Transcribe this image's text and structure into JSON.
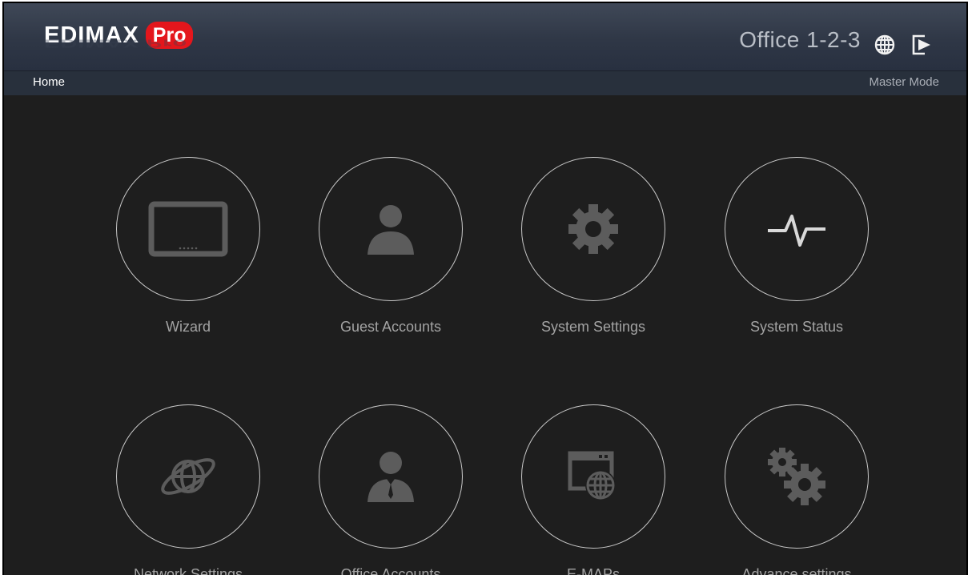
{
  "header": {
    "logo_main": "EDIMAX",
    "logo_pro": "Pro",
    "site_name": "Office 1-2-3",
    "language_icon": "globe-icon",
    "logout_icon": "logout-icon"
  },
  "navbar": {
    "breadcrumb": "Home",
    "mode": "Master Mode"
  },
  "tiles": [
    {
      "label": "Wizard",
      "icon": "monitor-icon"
    },
    {
      "label": "Guest Accounts",
      "icon": "user-icon"
    },
    {
      "label": "System Settings",
      "icon": "gear-icon"
    },
    {
      "label": "System Status",
      "icon": "pulse-icon"
    },
    {
      "label": "Network Settings",
      "icon": "orbit-globe-icon"
    },
    {
      "label": "Office Accounts",
      "icon": "business-user-icon"
    },
    {
      "label": "E-MAPs",
      "icon": "web-map-icon"
    },
    {
      "label": "Advance settings",
      "icon": "gears-icon"
    }
  ],
  "colors": {
    "background": "#1e1e1e",
    "header": "#2f3746",
    "icon": "#5c5c5c",
    "brand_red": "#e4161c"
  }
}
